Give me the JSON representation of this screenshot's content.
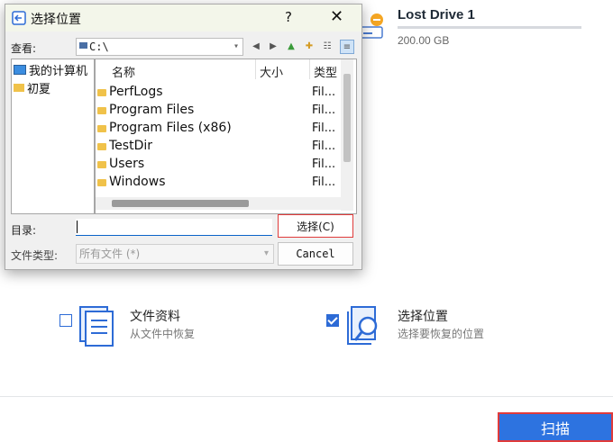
{
  "drive": {
    "name": "Lost Drive 1",
    "size": "200.00 GB"
  },
  "options": [
    {
      "title": "文件资料",
      "subtitle": "从文件中恢复",
      "checked": false
    },
    {
      "title": "选择位置",
      "subtitle": "选择要恢复的位置",
      "checked": true
    }
  ],
  "scan_button": "扫描",
  "dialog": {
    "title": "选择位置",
    "help": "?",
    "close": "✕",
    "lookin_label": "查看:",
    "lookin_value": "C:\\",
    "tree": [
      "我的计算机",
      "初夏"
    ],
    "columns": {
      "name": "名称",
      "size": "大小",
      "type": "类型"
    },
    "files": [
      {
        "name": "PerfLogs",
        "type": "Fil..."
      },
      {
        "name": "Program Files",
        "type": "Fil..."
      },
      {
        "name": "Program Files (x86)",
        "type": "Fil..."
      },
      {
        "name": "TestDir",
        "type": "Fil..."
      },
      {
        "name": "Users",
        "type": "Fil..."
      },
      {
        "name": "Windows",
        "type": "Fil..."
      }
    ],
    "dir_label": "目录:",
    "dir_value": "",
    "select_button": "选择(C)",
    "filetype_label": "文件类型:",
    "filetype_value": "所有文件 (*)",
    "cancel_button": "Cancel"
  },
  "colors": {
    "accent": "#2d73e0",
    "highlight": "#e03b3b",
    "folder": "#f0c24a"
  }
}
